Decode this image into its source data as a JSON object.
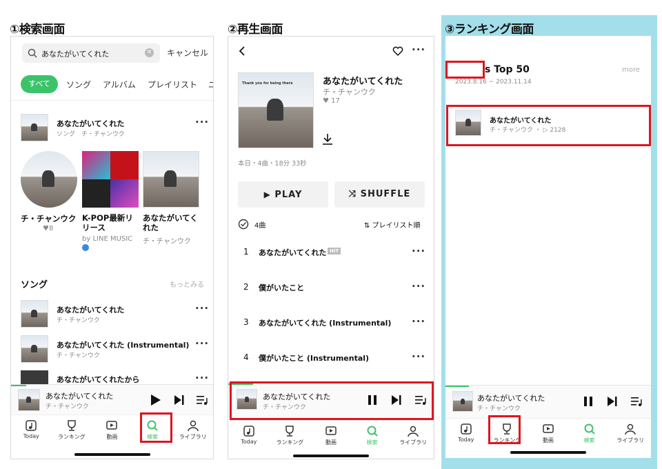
{
  "titles": {
    "search": "①検索画面",
    "play": "②再生画面",
    "ranking": "③ランキング画面"
  },
  "search": {
    "query": "あなたがいてくれた",
    "cancel": "キャンセル",
    "chips": [
      "すべて",
      "ソング",
      "アルバム",
      "プレイリスト",
      "ユ"
    ],
    "top": {
      "title": "あなたがいてくれた",
      "sub": "ソング　チ・チャンウク"
    },
    "cards": [
      {
        "title": "チ・チャンウク",
        "sub": "♥8"
      },
      {
        "title": "K-POP最新リリース",
        "sub": "by LINE MUSIC"
      },
      {
        "title": "あなたがいてくれた",
        "sub": "チ・チャンウク"
      }
    ],
    "songs_heading": "ソング",
    "see_more": "もっとみる",
    "songs": [
      {
        "title": "あなたがいてくれた",
        "sub": "チ・チャンウク"
      },
      {
        "title": "あなたがいてくれた (Instrumental)",
        "sub": "チ・チャンウク"
      },
      {
        "title": "あなたがいてくれたから",
        "sub": ""
      }
    ]
  },
  "play": {
    "album_title": "あなたがいてくれた",
    "artist": "チ・チャンウク",
    "likes": "17",
    "meta": "本日・4曲・18分 33秒",
    "play_label": "PLAY",
    "shuffle_label": "SHUFFLE",
    "count": "4曲",
    "order_label": "プレイリスト順",
    "hit_badge": "HIT",
    "cover_text": "Thank you for being there",
    "tracks": [
      {
        "no": "1",
        "title": "あなたがいてくれた"
      },
      {
        "no": "2",
        "title": "僕がいたこと"
      },
      {
        "no": "3",
        "title": "あなたがいてくれた (Instrumental)"
      },
      {
        "no": "4",
        "title": "僕がいたこと (Instrumental)"
      }
    ]
  },
  "ranking": {
    "title": "s Top 50",
    "more": "more",
    "dates": "2023.8.16 ~ 2023.11.14",
    "item": {
      "title": "あなたがいてくれた",
      "sub": "チ・チャンウク ・ ▷ 2128"
    }
  },
  "miniplayer": {
    "title": "あなたがいてくれた",
    "artist": "チ・チャンウク"
  },
  "tabs": [
    "Today",
    "ランキング",
    "動画",
    "検索",
    "ライブラリ"
  ],
  "colors": {
    "accent": "#3cc36a",
    "highlight": "#e0141e",
    "ranking_bg": "#a3dfea"
  }
}
